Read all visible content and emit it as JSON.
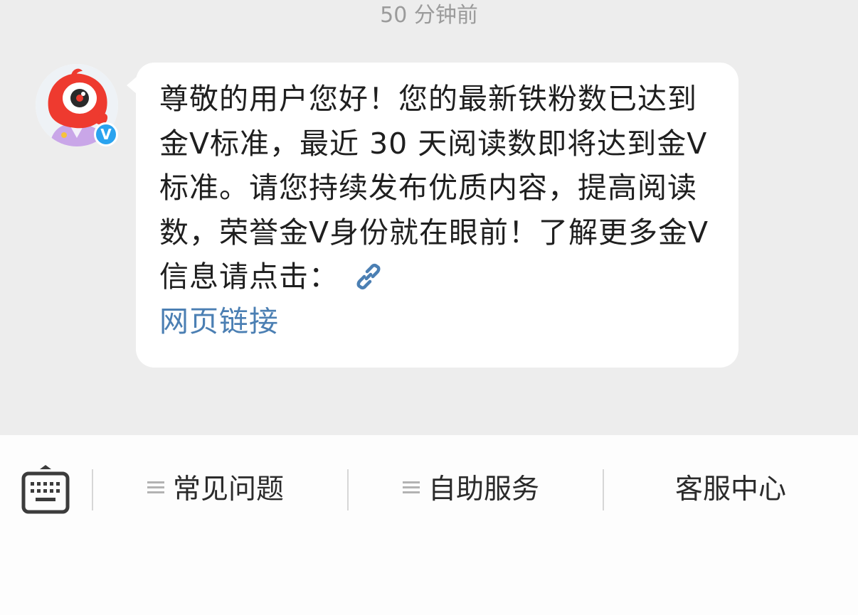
{
  "timestamp": "50 分钟前",
  "sender": {
    "avatar_icon": "weibo-mascot-icon",
    "verified_icon": "verified-v-badge-icon",
    "verified_label": "V"
  },
  "message": {
    "text": "尊敬的用户您好！您的最新铁粉数已达到金Ⅴ标准，最近 30 天阅读数即将达到金Ⅴ标准。请您持续发布优质内容，提高阅读数，荣誉金Ⅴ身份就在眼前！了解更多金Ⅴ信息请点击：",
    "link_icon": "link-chain-icon",
    "link_text": "网页链接",
    "link_color": "#4b7fb3"
  },
  "toolbar": {
    "keyboard_icon": "keyboard-icon",
    "menu_icon": "menu-lines-icon",
    "items": [
      {
        "label": "常见问题",
        "has_menu_icon": true
      },
      {
        "label": "自助服务",
        "has_menu_icon": true
      },
      {
        "label": "客服中心",
        "has_menu_icon": false
      }
    ]
  },
  "colors": {
    "chat_background": "#ededed",
    "bubble_background": "#ffffff",
    "verified_badge": "#2aa3ef",
    "toolbar_background": "#fdfdfd"
  }
}
